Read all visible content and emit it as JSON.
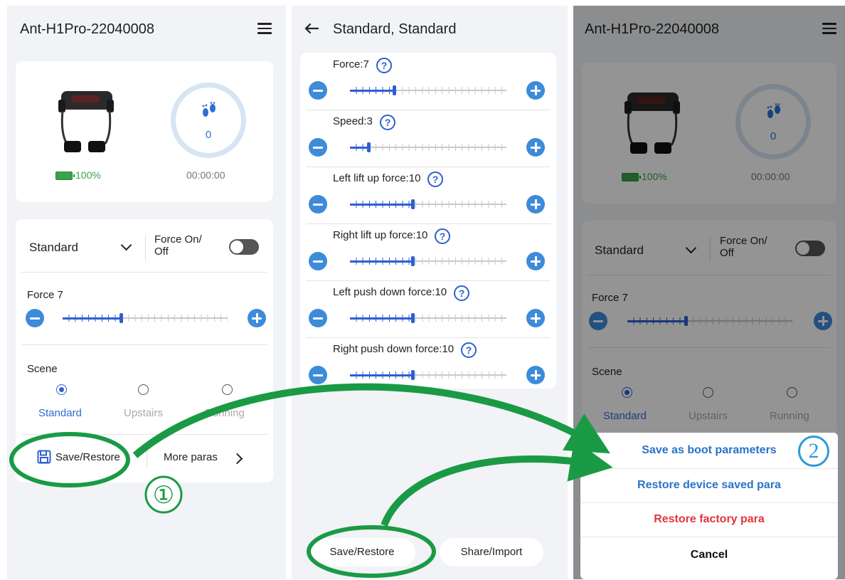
{
  "left_screen": {
    "title": "Ant-H1Pro-22040008",
    "battery": "100%",
    "steps": "0",
    "timer": "00:00:00",
    "mode_select": "Standard",
    "force_toggle_label": "Force On/ Off",
    "force_label": "Force 7",
    "force_value": 7,
    "scene_label": "Scene",
    "scenes": [
      {
        "label": "Standard",
        "selected": true
      },
      {
        "label": "Upstairs",
        "selected": false
      },
      {
        "label": "Running",
        "selected": false
      }
    ],
    "save_restore_label": "Save/Restore",
    "more_paras_label": "More paras"
  },
  "middle_screen": {
    "title": "Standard, Standard",
    "params": [
      {
        "label": "Force:7",
        "value": 7
      },
      {
        "label": "Speed:3",
        "value": 3
      },
      {
        "label": "Left lift up force:10",
        "value": 10
      },
      {
        "label": "Right lift up force:10",
        "value": 10
      },
      {
        "label": "Left push down force:10",
        "value": 10
      },
      {
        "label": "Right push down force:10",
        "value": 10
      }
    ],
    "save_restore_label": "Save/Restore",
    "share_import_label": "Share/Import"
  },
  "right_screen": {
    "title": "Ant-H1Pro-22040008",
    "battery": "100%",
    "steps": "0",
    "timer": "00:00:00",
    "mode_select": "Standard",
    "force_toggle_label": "Force On/ Off",
    "force_label": "Force 7",
    "scene_label": "Scene",
    "scenes": [
      {
        "label": "Standard",
        "selected": true
      },
      {
        "label": "Upstairs",
        "selected": false
      },
      {
        "label": "Running",
        "selected": false
      }
    ],
    "sheet": {
      "save_boot": "Save as boot parameters",
      "restore_device": "Restore device saved para",
      "restore_factory": "Restore factory para",
      "cancel": "Cancel"
    }
  },
  "annotations": {
    "step1": "①",
    "step2": "2"
  },
  "colors": {
    "accent_blue": "#2e5fd1",
    "button_blue": "#3d8bd9",
    "arrow_green": "#1a9a45",
    "danger_red": "#e0353d",
    "sheet_blue": "#2a73c8"
  }
}
